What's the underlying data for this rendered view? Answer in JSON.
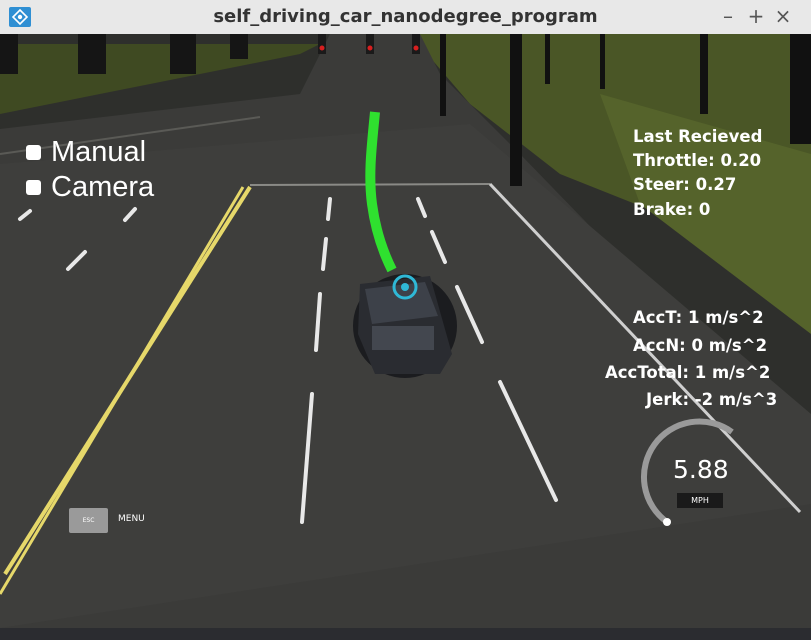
{
  "window": {
    "title": "self_driving_car_nanodegree_program",
    "controls": {
      "minimize": "–",
      "maximize": "+",
      "close": "×"
    }
  },
  "toggles": [
    {
      "label": "Manual"
    },
    {
      "label": "Camera"
    }
  ],
  "telemetry": {
    "heading": "Last Recieved",
    "throttle": "Throttle: 0.20",
    "steer": "Steer: 0.27",
    "brake": "Brake: 0"
  },
  "acceleration": {
    "acc_t": "AccT: 1 m/s^2",
    "acc_n": "AccN: 0 m/s^2",
    "acc_total": "AccTotal: 1 m/s^2",
    "jerk": "Jerk: -2 m/s^3"
  },
  "speedometer": {
    "value": "5.88",
    "unit": "MPH"
  },
  "menu": {
    "esc_label": "ESC",
    "menu_label": "MENU"
  },
  "colors": {
    "path": "#2fe02f",
    "grass": "#3d4a22",
    "road": "#3c3c3a",
    "lane_yellow": "#e6d86a",
    "app_icon": "#2f8fd3"
  }
}
